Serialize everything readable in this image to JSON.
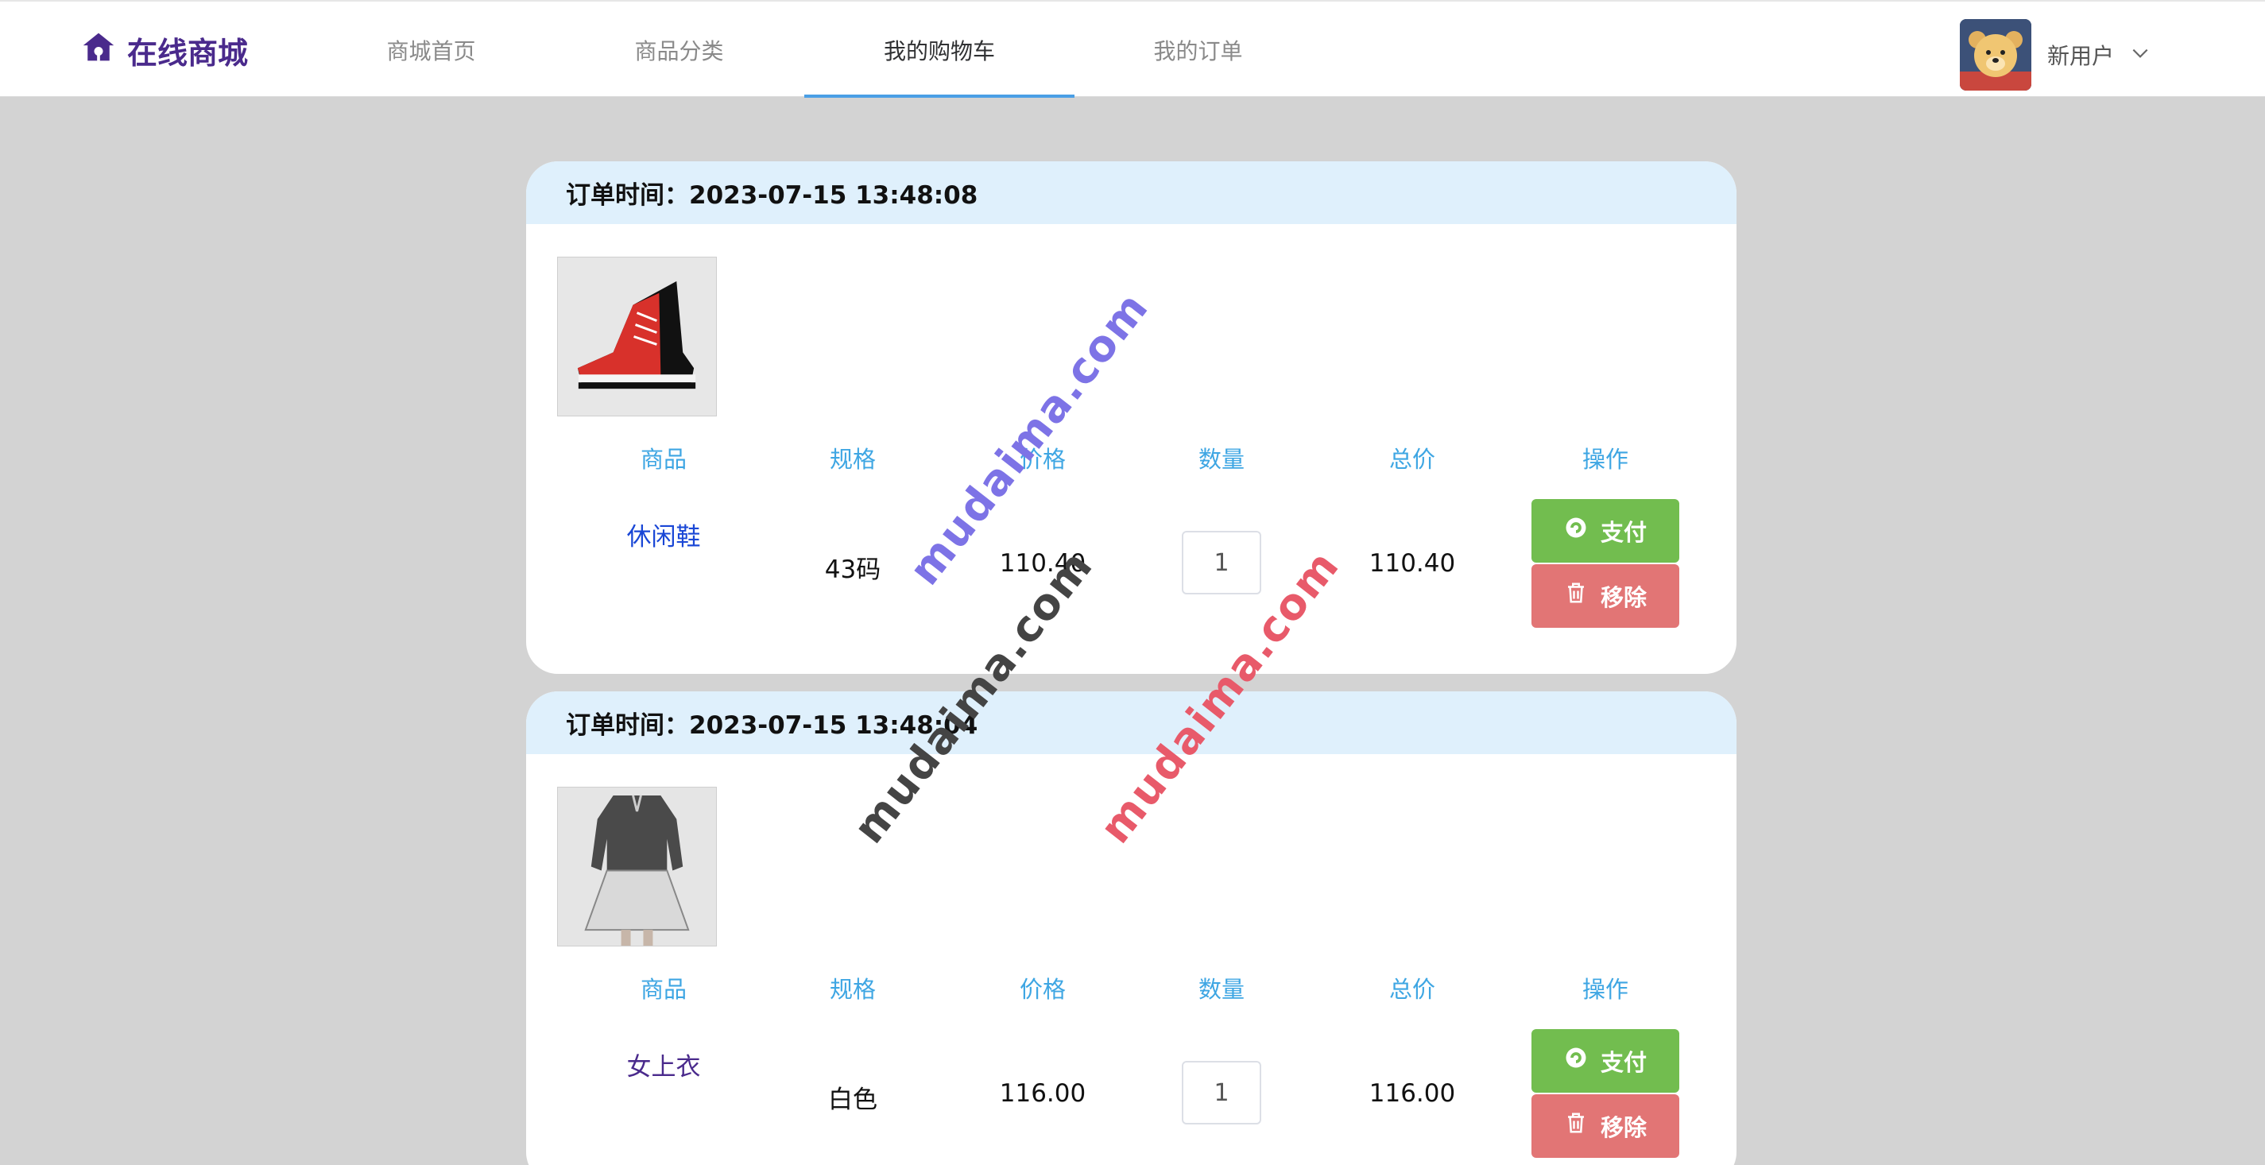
{
  "brand": {
    "name": "在线商城"
  },
  "nav": {
    "items": [
      {
        "label": "商城首页"
      },
      {
        "label": "商品分类"
      },
      {
        "label": "我的购物车"
      },
      {
        "label": "我的订单"
      }
    ],
    "active_index": 2
  },
  "user": {
    "name": "新用户"
  },
  "table_headers": {
    "product": "商品",
    "spec": "规格",
    "price": "价格",
    "quantity": "数量",
    "total": "总价",
    "action": "操作"
  },
  "buttons": {
    "pay": "支付",
    "remove": "移除"
  },
  "orders": [
    {
      "time_label": "订单时间：2023-07-15 13:48:08",
      "product_name": "休闲鞋",
      "spec": "43码",
      "price": "110.40",
      "quantity": "1",
      "total": "110.40",
      "image_icon": "sneaker-image"
    },
    {
      "time_label": "订单时间：2023-07-15 13:48:04",
      "product_name": "女上衣",
      "spec": "白色",
      "price": "116.00",
      "quantity": "1",
      "total": "116.00",
      "image_icon": "blouse-image"
    }
  ],
  "watermarks": [
    "mudaima.com",
    "mudaima.com",
    "mudaima.com"
  ],
  "colors": {
    "brand": "#4a2a8c",
    "accent": "#4a9fe5",
    "header_label": "#3ea6e3",
    "pay": "#72bd4f",
    "remove": "#e27575",
    "order_head_bg": "#dff0fc"
  }
}
